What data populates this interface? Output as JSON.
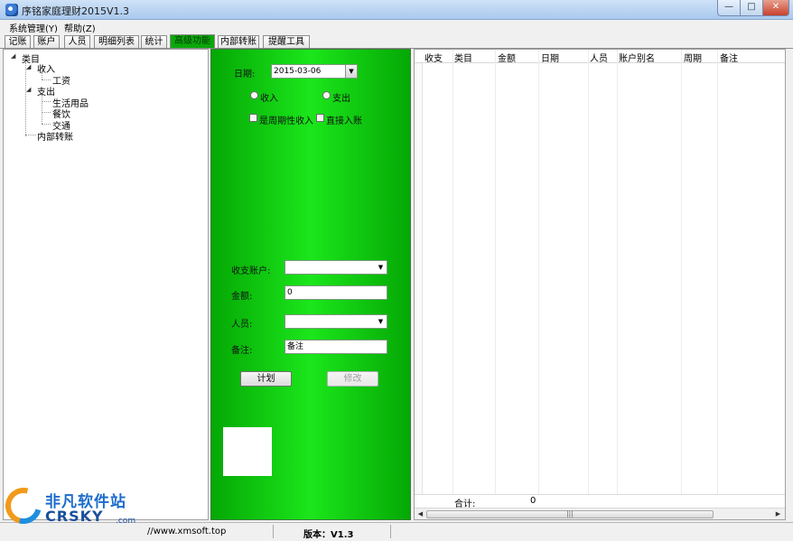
{
  "window": {
    "title": "序铭家庭理财2015V1.3",
    "min": "—",
    "max": "□",
    "close": "✕"
  },
  "menu": [
    "系统管理(Y)",
    "帮助(Z)"
  ],
  "tabs": [
    "记账",
    "账户",
    "人员",
    "明细列表",
    "统计",
    "高级功能",
    "内部转账",
    "提醒工具"
  ],
  "active_tab_index": 5,
  "tree": {
    "root": "类目",
    "income": "收入",
    "income_children": [
      "工资"
    ],
    "expense": "支出",
    "expense_children": [
      "生活用品",
      "餐饮",
      "交通"
    ],
    "transfer": "内部转账"
  },
  "form": {
    "date_label": "日期:",
    "date_value": "2015-03-06",
    "radio_income": "收入",
    "radio_expense": "支出",
    "check_periodic": "是周期性收入",
    "check_direct": "直接入账",
    "account_label": "收支账户:",
    "account_value": "",
    "amount_label": "金额:",
    "amount_value": "0",
    "person_label": "人员:",
    "person_value": "",
    "note_label": "备注:",
    "note_value": "备注",
    "plan_button": "计划",
    "modify_button": "修改"
  },
  "grid": {
    "columns": [
      "收支",
      "类目",
      "金额",
      "日期",
      "人员",
      "账户别名",
      "周期",
      "备注"
    ],
    "total_label": "合计:",
    "total_value": "0",
    "scroll_grip": "|||"
  },
  "status": {
    "website": "//www.xmsoft.top",
    "version": "版本：V1.3"
  },
  "watermark": {
    "cn": "非凡软件站",
    "en": "CRSKY",
    "dotcom": ".com"
  }
}
